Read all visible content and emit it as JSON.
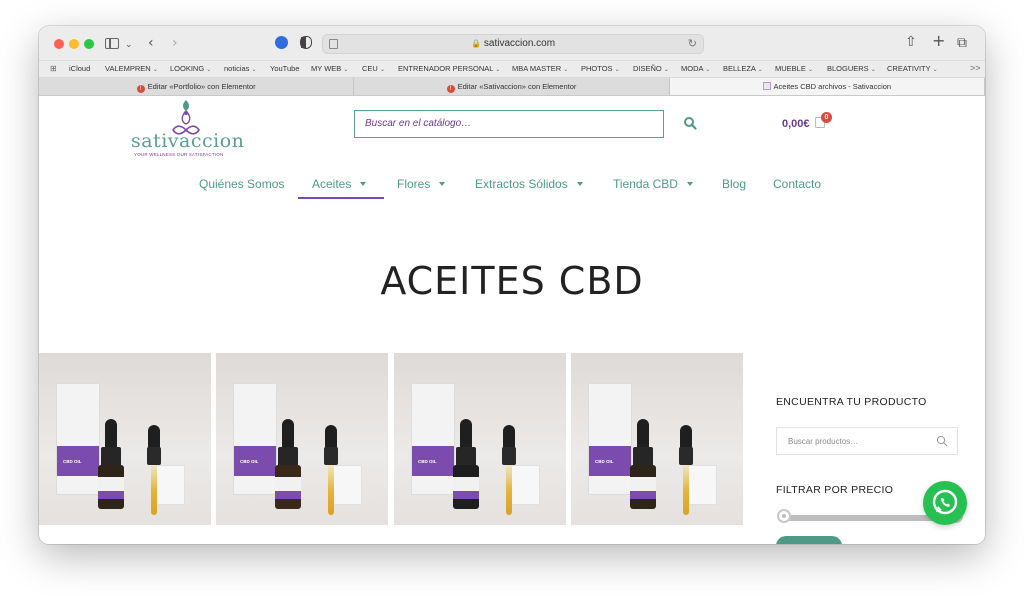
{
  "browser": {
    "url": "sativaccion.com",
    "bookmarks": [
      {
        "label": "iCloud",
        "caret": false
      },
      {
        "label": "VALEMPREN",
        "caret": true
      },
      {
        "label": "LOOKING",
        "caret": true
      },
      {
        "label": "noticias",
        "caret": true
      },
      {
        "label": "YouTube",
        "caret": false
      },
      {
        "label": "MY WEB",
        "caret": true
      },
      {
        "label": "CEU",
        "caret": true
      },
      {
        "label": "ENTRENADOR PERSONAL",
        "caret": true
      },
      {
        "label": "MBA MASTER",
        "caret": true
      },
      {
        "label": "PHOTOS",
        "caret": true
      },
      {
        "label": "DISEÑO",
        "caret": true
      },
      {
        "label": "MODA",
        "caret": true
      },
      {
        "label": "BELLEZA",
        "caret": true
      },
      {
        "label": "MUEBLE",
        "caret": true
      },
      {
        "label": "BLOGUERS",
        "caret": true
      },
      {
        "label": "CREATIVITY",
        "caret": true
      }
    ],
    "overflow_label": ">>",
    "tabs": [
      {
        "label": "Editar «Portfolio» con Elementor",
        "active": false
      },
      {
        "label": "Editar «Sativaccion» con Elementor",
        "active": false
      },
      {
        "label": "Aceites CBD archivos - Sativaccion",
        "active": true
      }
    ]
  },
  "site": {
    "logo_text": "sativaccion",
    "logo_tagline": "YOUR WELLNESS OUR SATISFACTION",
    "search_placeholder": "Buscar en el catálogo…",
    "cart_total": "0,00€",
    "cart_count": "0",
    "nav": [
      {
        "label": "Quiénes Somos",
        "dropdown": false
      },
      {
        "label": "Aceites",
        "dropdown": true,
        "active": true
      },
      {
        "label": "Flores",
        "dropdown": true
      },
      {
        "label": "Extractos Sólidos",
        "dropdown": true
      },
      {
        "label": "Tienda CBD",
        "dropdown": true
      },
      {
        "label": "Blog",
        "dropdown": false
      },
      {
        "label": "Contacto",
        "dropdown": false
      }
    ],
    "page_title": "ACEITES CBD",
    "products": [
      {
        "box_text": "CBD OIL",
        "liquid": "gold"
      },
      {
        "box_text": "CBD OIL",
        "liquid": "amber"
      },
      {
        "box_text": "CBD OIL",
        "liquid": "dark"
      },
      {
        "box_text": "CBD OIL",
        "liquid": "gold"
      }
    ],
    "sidebar": {
      "find_title": "ENCUENTRA TU PRODUCTO",
      "search_placeholder": "Buscar productos…",
      "price_title": "FILTRAR POR PRECIO"
    }
  },
  "colors": {
    "brand_green": "#4e9a87",
    "brand_purple": "#7b4bb0",
    "badge_red": "#d54e3d",
    "whatsapp": "#26c152"
  }
}
